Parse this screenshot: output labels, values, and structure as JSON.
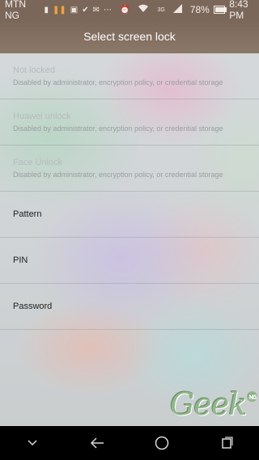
{
  "status_bar": {
    "carrier": "MTN NG",
    "battery": "78%",
    "battery_level": 0.78,
    "time": "8:43 PM",
    "network": "3G"
  },
  "header": {
    "title": "Select screen lock"
  },
  "lock_options": [
    {
      "label": "Not locked",
      "description": "Disabled by administrator, encryption policy, or credential storage",
      "enabled": false
    },
    {
      "label": "Huawei unlock",
      "description": "Disabled by administrator, encryption policy, or credential storage",
      "enabled": false
    },
    {
      "label": "Face Unlock",
      "description": "Disabled by administrator, encryption policy, or credential storage",
      "enabled": false
    },
    {
      "label": "Pattern",
      "enabled": true
    },
    {
      "label": "PIN",
      "enabled": true
    },
    {
      "label": "Password",
      "enabled": true
    }
  ],
  "watermark": {
    "text": "Geek",
    "badge": "NG"
  },
  "nav_bar": {
    "icons": [
      "chevron-down-icon",
      "back-icon",
      "home-icon",
      "recents-icon"
    ]
  },
  "colors": {
    "header_bg": "#7b6759",
    "nav_bg": "#000000",
    "pause_icon": "#f0a23c"
  }
}
